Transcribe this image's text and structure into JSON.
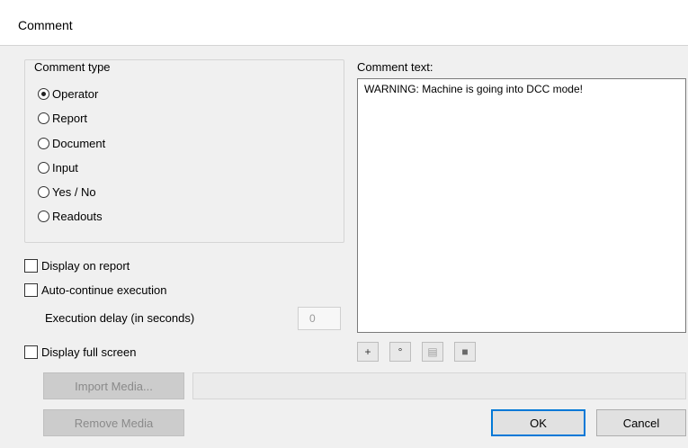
{
  "window": {
    "title": "Comment"
  },
  "comment_type": {
    "title": "Comment type",
    "options": [
      {
        "label": "Operator",
        "checked": true
      },
      {
        "label": "Report",
        "checked": false
      },
      {
        "label": "Document",
        "checked": false
      },
      {
        "label": "Input",
        "checked": false
      },
      {
        "label": "Yes / No",
        "checked": false
      },
      {
        "label": "Readouts",
        "checked": false
      }
    ]
  },
  "options": {
    "display_on_report": {
      "label": "Display on report",
      "checked": false
    },
    "auto_continue": {
      "label": "Auto-continue execution",
      "checked": false
    },
    "execution_delay": {
      "label": "Execution delay (in seconds)",
      "value": "0"
    },
    "display_full_screen": {
      "label": "Display full screen",
      "checked": false
    }
  },
  "comment_text": {
    "label": "Comment text:",
    "value": "WARNING: Machine is going into DCC mode!"
  },
  "toolbar": {
    "buttons": [
      {
        "icon": "plus-minus-icon",
        "glyph": "+"
      },
      {
        "icon": "degree-icon",
        "glyph": "°"
      },
      {
        "icon": "table-icon",
        "glyph": "▤"
      },
      {
        "icon": "image-icon",
        "glyph": "■"
      }
    ]
  },
  "media": {
    "import_label": "Import Media...",
    "remove_label": "Remove Media",
    "path_value": ""
  },
  "actions": {
    "ok_label": "OK",
    "cancel_label": "Cancel"
  },
  "colors": {
    "accent": "#0078d7",
    "background": "#f0f0f0"
  }
}
